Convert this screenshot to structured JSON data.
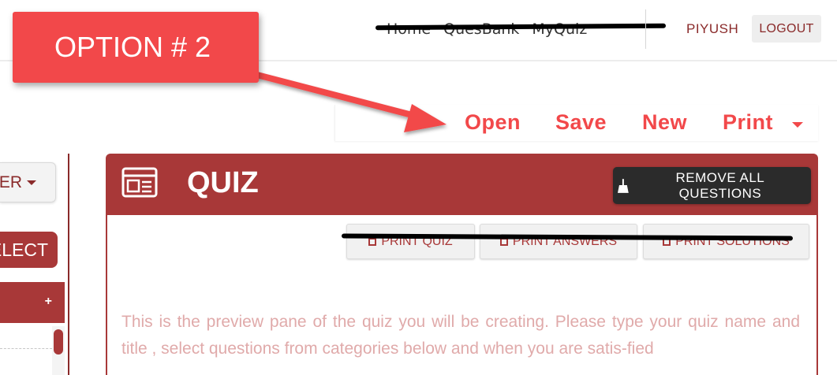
{
  "nav": {
    "links": [
      "Home",
      "QuesBank",
      "MyQuiz"
    ],
    "user": "PIYUSH",
    "logout": "LOGOUT"
  },
  "annotation": {
    "label": "OPTION # 2",
    "color": "#f2484a"
  },
  "toolbar": {
    "open": "Open",
    "save": "Save",
    "new": "New",
    "print": "Print"
  },
  "sidebar": {
    "filter_label": "TER",
    "select_label": "ELECT",
    "category_plus": "+"
  },
  "quiz": {
    "title": "QUIZ",
    "icon": "newspaper-icon",
    "remove_all": "REMOVE ALL QUESTIONS",
    "remove_icon": "broom-icon",
    "print_quiz": "PRINT QUIZ",
    "print_answers": "PRINT ANSWERS",
    "print_solutions": "PRINT SOLUTIONS",
    "preview_text": "This is the preview pane of the quiz you will be creating. Please type your quiz name and title , select questions from categories below and when you are satis-fied"
  },
  "colors": {
    "brand": "#a83838",
    "accent": "#f2484a",
    "dark_button": "#2b2b2b",
    "preview_text": "#e0aaaa"
  }
}
